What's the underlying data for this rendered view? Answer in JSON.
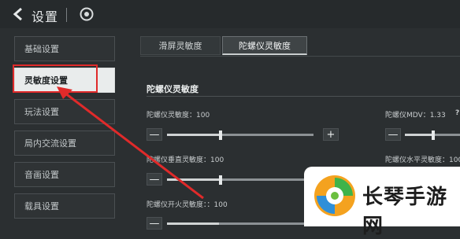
{
  "header": {
    "title": "设置"
  },
  "sidebar": {
    "items": [
      {
        "label": "基础设置"
      },
      {
        "label": "灵敏度设置"
      },
      {
        "label": "玩法设置"
      },
      {
        "label": "局内交流设置"
      },
      {
        "label": "音画设置"
      },
      {
        "label": "载具设置"
      }
    ],
    "selected_index": 1
  },
  "tabs": [
    {
      "label": "滑屏灵敏度"
    },
    {
      "label": "陀螺仪灵敏度"
    }
  ],
  "section": {
    "title": "陀螺仪灵敏度"
  },
  "sliders": [
    {
      "label": "陀螺仪灵敏度：100",
      "value": 100,
      "min_label": "−",
      "plus_label": "+"
    },
    {
      "label": "陀螺仪垂直灵敏度：100",
      "value": 100
    },
    {
      "label": "陀螺仪开火灵敏度：：100",
      "value": 100
    },
    {
      "label": "陀螺仪MDV：1.33",
      "help": "?"
    },
    {
      "label": "陀螺仪水平灵敏度：100",
      "value": 100
    }
  ],
  "buttons": {
    "minus": "—",
    "plus": "+"
  },
  "watermark": {
    "text": "长琴手游网"
  },
  "colors": {
    "background": "#2b2f31",
    "highlight": "#e02a2a",
    "active_item_bg": "#e9ecec"
  }
}
